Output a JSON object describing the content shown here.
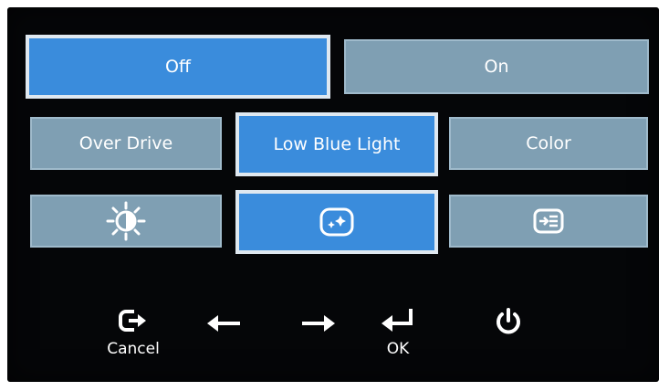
{
  "menu": {
    "mode_options": [
      {
        "label": "Off",
        "selected": true
      },
      {
        "label": "On",
        "selected": false
      }
    ],
    "categories": [
      {
        "label": "Over Drive",
        "selected": false
      },
      {
        "label": "Low Blue Light",
        "selected": true
      },
      {
        "label": "Color",
        "selected": false
      }
    ],
    "icon_tiles": [
      {
        "icon": "brightness-contrast-icon",
        "selected": false
      },
      {
        "icon": "image-effect-icon",
        "selected": true
      },
      {
        "icon": "input-source-icon",
        "selected": false
      }
    ]
  },
  "keys": {
    "cancel_label": "Cancel",
    "ok_label": "OK",
    "left_icon": "arrow-left-icon",
    "right_icon": "arrow-right-icon",
    "power_icon": "power-icon",
    "cancel_icon": "exit-icon",
    "ok_icon": "enter-icon"
  },
  "colors": {
    "selected": "#3a8cdc",
    "unselected": "#7f9fb3",
    "background": "#050608"
  }
}
